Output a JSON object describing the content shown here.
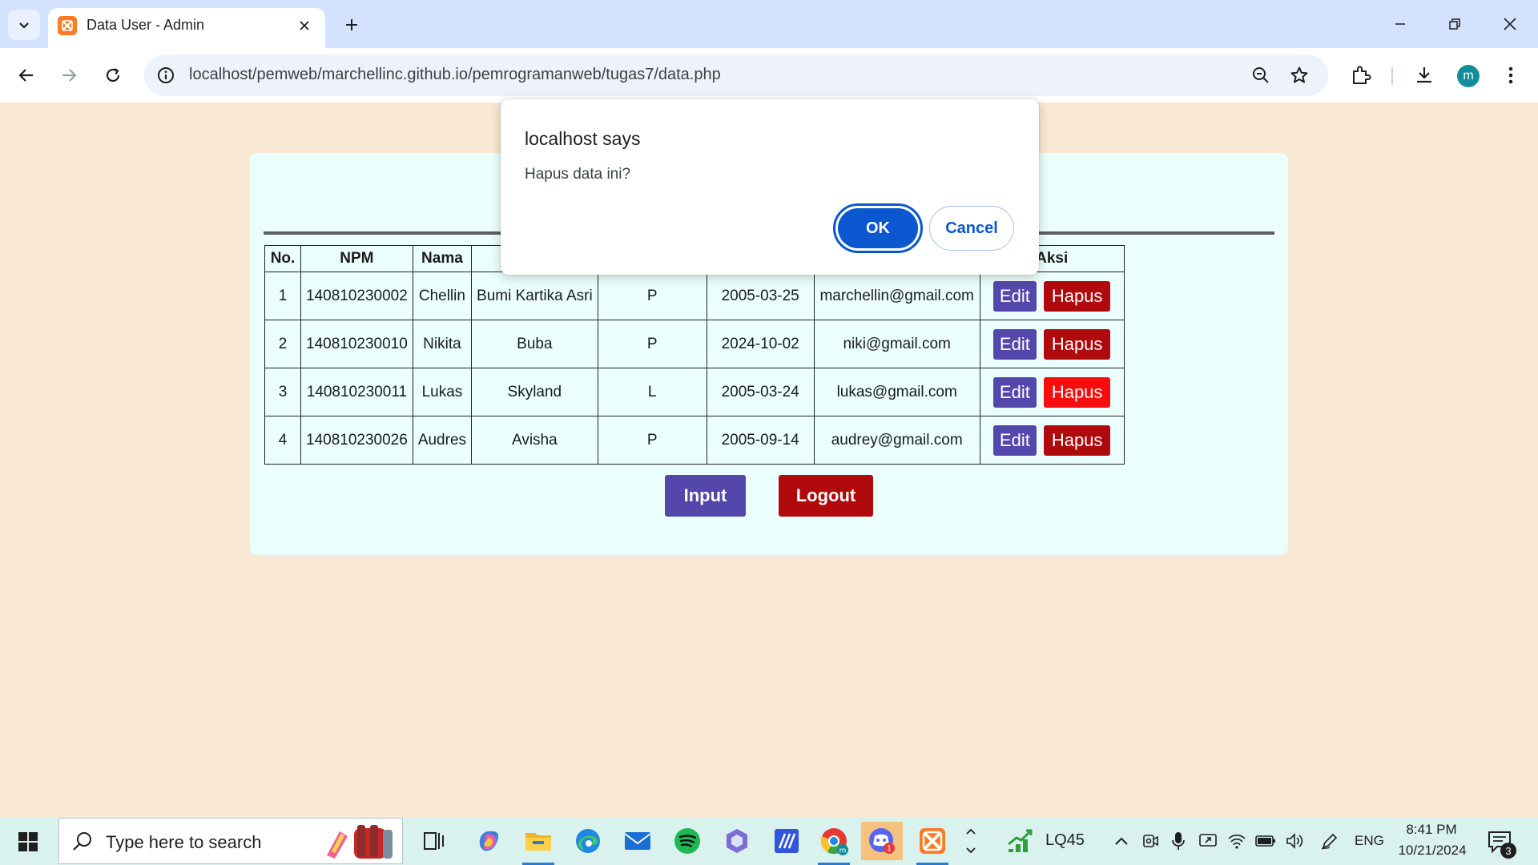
{
  "browser": {
    "tab_title": "Data User - Admin",
    "url": "localhost/pemweb/marchellinc.github.io/pemrogramanweb/tugas7/data.php",
    "profile_initial": "m"
  },
  "table": {
    "headers": [
      "No.",
      "NPM",
      "Nama",
      "",
      "",
      "",
      "",
      "Aksi"
    ],
    "rows": [
      {
        "no": "1",
        "npm": "140810230002",
        "nama": "Chellin",
        "alamat": "Bumi Kartika Asri",
        "jk": "P",
        "tgl": "2005-03-25",
        "email": "marchellin@gmail.com"
      },
      {
        "no": "2",
        "npm": "140810230010",
        "nama": "Nikita",
        "alamat": "Buba",
        "jk": "P",
        "tgl": "2024-10-02",
        "email": "niki@gmail.com"
      },
      {
        "no": "3",
        "npm": "140810230011",
        "nama": "Lukas",
        "alamat": "Skyland",
        "jk": "L",
        "tgl": "2005-03-24",
        "email": "lukas@gmail.com"
      },
      {
        "no": "4",
        "npm": "140810230026",
        "nama": "Audres",
        "alamat": "Avisha",
        "jk": "P",
        "tgl": "2005-09-14",
        "email": "audrey@gmail.com"
      }
    ],
    "edit_label": "Edit",
    "hapus_label": "Hapus"
  },
  "buttons": {
    "input_label": "Input",
    "logout_label": "Logout"
  },
  "dialog": {
    "title": "localhost says",
    "message": "Hapus data ini?",
    "ok_label": "OK",
    "cancel_label": "Cancel"
  },
  "taskbar": {
    "search_placeholder": "Type here to search",
    "stock_label": "LQ45",
    "language": "ENG",
    "time": "8:41 PM",
    "date": "10/21/2024",
    "notification_count": "3",
    "discord_badge": "1"
  },
  "colors": {
    "page_bg": "#f9e8d3",
    "panel_bg": "#ebfffd",
    "edit_button": "#5347ab",
    "hapus_button": "#b00a0c",
    "dialog_accent": "#0b57d0"
  }
}
